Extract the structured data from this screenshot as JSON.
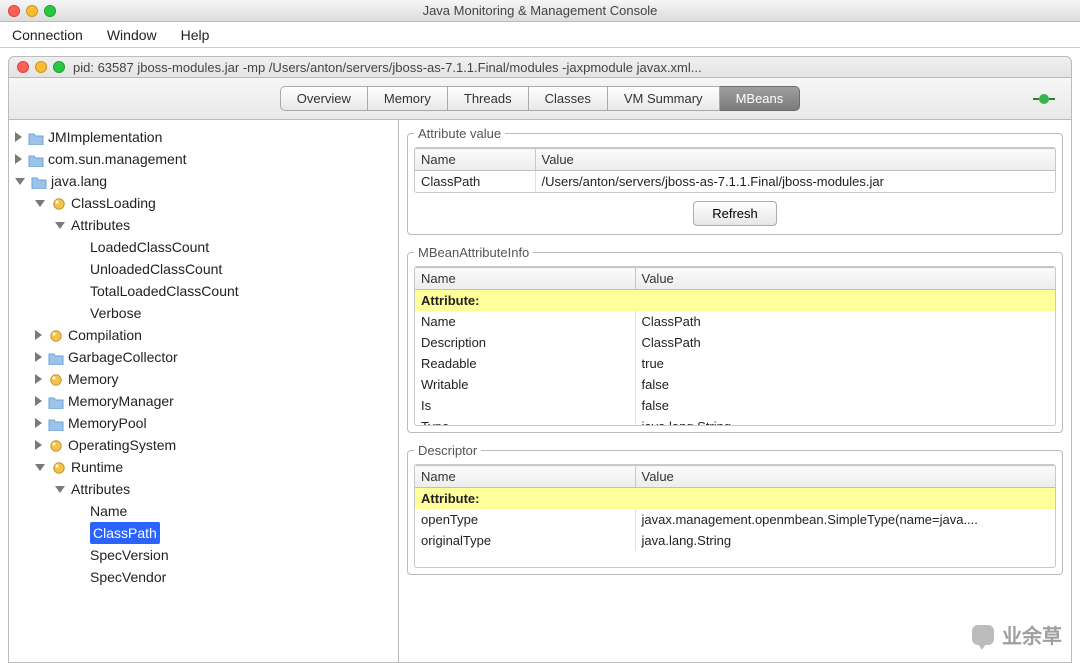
{
  "window": {
    "title": "Java Monitoring & Management Console"
  },
  "menu": {
    "items": [
      "Connection",
      "Window",
      "Help"
    ]
  },
  "doc": {
    "title": "pid: 63587 jboss-modules.jar -mp /Users/anton/servers/jboss-as-7.1.1.Final/modules -jaxpmodule javax.xml..."
  },
  "tabs": {
    "items": [
      "Overview",
      "Memory",
      "Threads",
      "Classes",
      "VM Summary",
      "MBeans"
    ],
    "activeIndex": 5
  },
  "tree": {
    "nodes": [
      {
        "label": "JMImplementation",
        "icon": "folder",
        "state": "closed"
      },
      {
        "label": "com.sun.management",
        "icon": "folder",
        "state": "closed"
      },
      {
        "label": "java.lang",
        "icon": "folder",
        "state": "open",
        "children": [
          {
            "label": "ClassLoading",
            "icon": "bean",
            "state": "open",
            "children": [
              {
                "label": "Attributes",
                "icon": "none",
                "state": "open",
                "children": [
                  {
                    "label": "LoadedClassCount",
                    "icon": "none",
                    "state": "leaf"
                  },
                  {
                    "label": "UnloadedClassCount",
                    "icon": "none",
                    "state": "leaf"
                  },
                  {
                    "label": "TotalLoadedClassCount",
                    "icon": "none",
                    "state": "leaf"
                  },
                  {
                    "label": "Verbose",
                    "icon": "none",
                    "state": "leaf"
                  }
                ]
              }
            ]
          },
          {
            "label": "Compilation",
            "icon": "bean",
            "state": "closed"
          },
          {
            "label": "GarbageCollector",
            "icon": "folder",
            "state": "closed"
          },
          {
            "label": "Memory",
            "icon": "bean",
            "state": "closed"
          },
          {
            "label": "MemoryManager",
            "icon": "folder",
            "state": "closed"
          },
          {
            "label": "MemoryPool",
            "icon": "folder",
            "state": "closed"
          },
          {
            "label": "OperatingSystem",
            "icon": "bean",
            "state": "closed"
          },
          {
            "label": "Runtime",
            "icon": "bean",
            "state": "open",
            "children": [
              {
                "label": "Attributes",
                "icon": "none",
                "state": "open",
                "children": [
                  {
                    "label": "Name",
                    "icon": "none",
                    "state": "leaf"
                  },
                  {
                    "label": "ClassPath",
                    "icon": "none",
                    "state": "leaf",
                    "selected": true
                  },
                  {
                    "label": "SpecVersion",
                    "icon": "none",
                    "state": "leaf"
                  },
                  {
                    "label": "SpecVendor",
                    "icon": "none",
                    "state": "leaf"
                  }
                ]
              }
            ]
          }
        ]
      }
    ]
  },
  "attrValue": {
    "legend": "Attribute value",
    "headers": [
      "Name",
      "Value"
    ],
    "row": {
      "name": "ClassPath",
      "value": "/Users/anton/servers/jboss-as-7.1.1.Final/jboss-modules.jar"
    },
    "refresh": "Refresh"
  },
  "attrInfo": {
    "legend": "MBeanAttributeInfo",
    "headers": [
      "Name",
      "Value"
    ],
    "section": "Attribute:",
    "rows": [
      {
        "name": "Name",
        "value": "ClassPath"
      },
      {
        "name": "Description",
        "value": "ClassPath"
      },
      {
        "name": "Readable",
        "value": "true"
      },
      {
        "name": "Writable",
        "value": "false"
      },
      {
        "name": "Is",
        "value": "false"
      },
      {
        "name": "Type",
        "value": "java.lang.String"
      }
    ]
  },
  "descriptor": {
    "legend": "Descriptor",
    "headers": [
      "Name",
      "Value"
    ],
    "section": "Attribute:",
    "rows": [
      {
        "name": "openType",
        "value": "javax.management.openmbean.SimpleType(name=java...."
      },
      {
        "name": "originalType",
        "value": "java.lang.String"
      }
    ]
  },
  "watermark": {
    "text": "业余草"
  }
}
